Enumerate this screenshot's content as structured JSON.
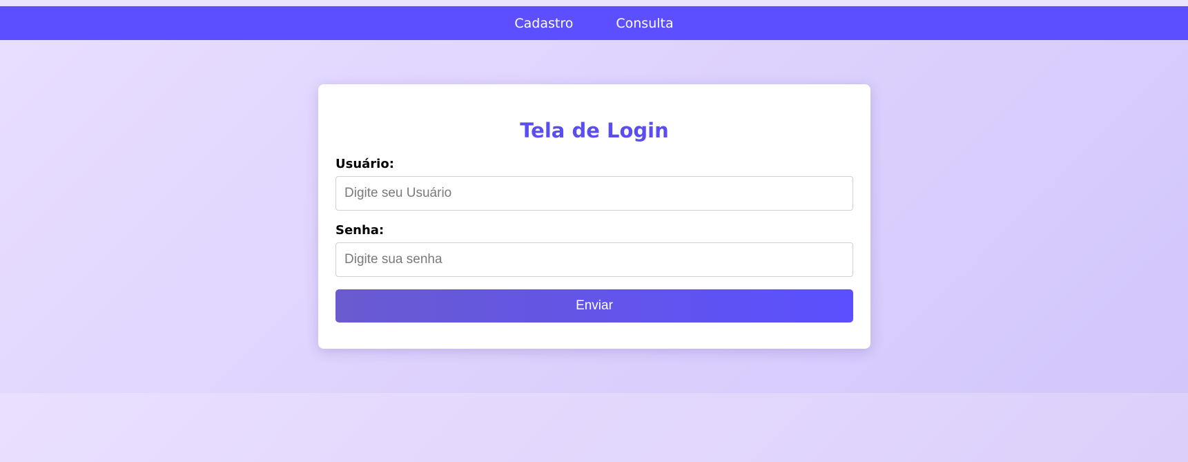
{
  "nav": {
    "items": [
      {
        "label": "Cadastro"
      },
      {
        "label": "Consulta"
      }
    ]
  },
  "login": {
    "title": "Tela de Login",
    "user_label": "Usuário:",
    "user_placeholder": "Digite seu Usuário",
    "user_value": "",
    "password_label": "Senha:",
    "password_placeholder": "Digite sua senha",
    "password_value": "",
    "submit_label": "Enviar"
  },
  "colors": {
    "accent": "#5b4fff",
    "title": "#5b4ef0",
    "background": "#e4daff"
  }
}
